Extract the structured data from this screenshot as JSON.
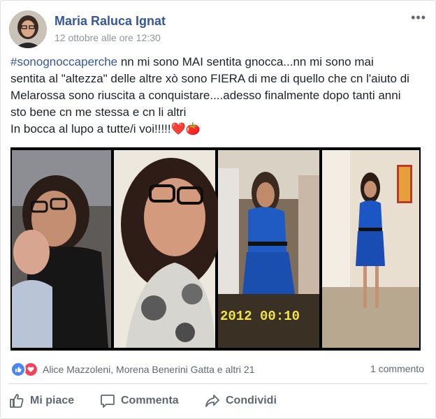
{
  "post": {
    "author": "Maria Raluca Ignat",
    "timestamp": "12 ottobre alle ore 12:30",
    "more_label": "•••",
    "hashtag": "#sonognoccaperche",
    "lines": [
      " nn mi sono MAI sentita gnocca...nn mi sono mai",
      "sentita al \"altezza\" delle altre xò sono FIERA di me di quello che cn l'aiuto di",
      "Melarossa sono riuscita a conquistare....adesso finalmente dopo tanti anni",
      "sto bene cn me stessa e cn li altri",
      "In bocca al lupo a tutte/i voi!!!!!"
    ],
    "emoji_heart": "❤️",
    "emoji_apple": "🍅",
    "photo_date_stamp": "2012 00:10"
  },
  "reactions": {
    "names": "Alice Mazzoleni, Morena Benerini Gatta e altri 21",
    "comments": "1 commento"
  },
  "actions": {
    "like": "Mi piace",
    "comment": "Commenta",
    "share": "Condividi"
  },
  "colors": {
    "link": "#365899",
    "meta": "#90949c",
    "action": "#606770",
    "like": "#4a87f4",
    "love": "#f3435a"
  }
}
